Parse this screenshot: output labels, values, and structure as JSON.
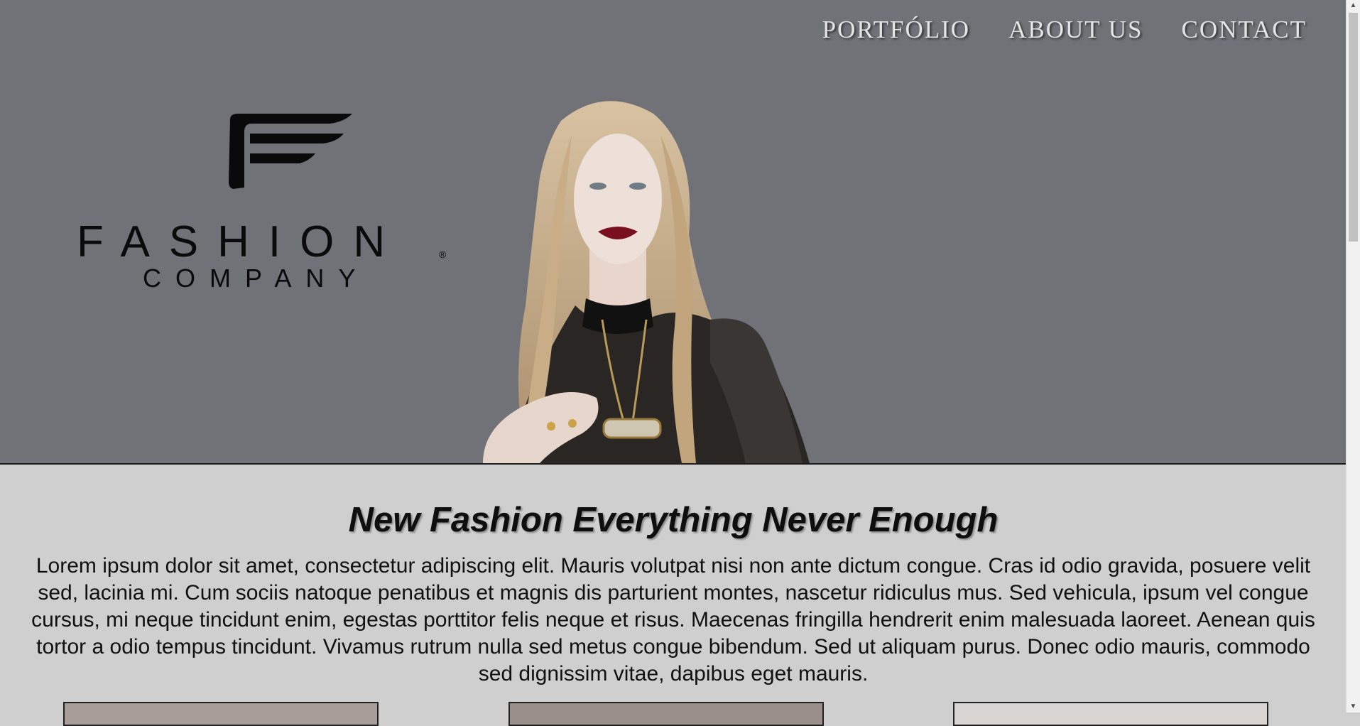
{
  "nav": {
    "items": [
      {
        "label": "PORTFÓLIO"
      },
      {
        "label": "ABOUT US"
      },
      {
        "label": "CONTACT"
      }
    ]
  },
  "logo": {
    "word": "FASHION",
    "sub": "COMPANY",
    "reg": "®"
  },
  "main": {
    "headline": "New Fashion Everything Never Enough",
    "body": "Lorem ipsum dolor sit amet, consectetur adipiscing elit. Mauris volutpat nisi non ante dictum congue. Cras id odio gravida, posuere velit sed, lacinia mi. Cum sociis natoque penatibus et magnis dis parturient montes, nascetur ridiculus mus. Sed vehicula, ipsum vel congue cursus, mi neque tincidunt enim, egestas porttitor felis neque et risus. Maecenas fringilla hendrerit enim malesuada laoreet. Aenean quis tortor a odio tempus tincidunt. Vivamus rutrum nulla sed metus congue bibendum. Sed ut aliquam purus. Donec odio mauris, commodo sed dignissim vitae, dapibus eget mauris."
  },
  "colors": {
    "hero_bg": "#717278",
    "page_bg": "#cfcfcf",
    "lipstick": "#7a0f1e"
  }
}
